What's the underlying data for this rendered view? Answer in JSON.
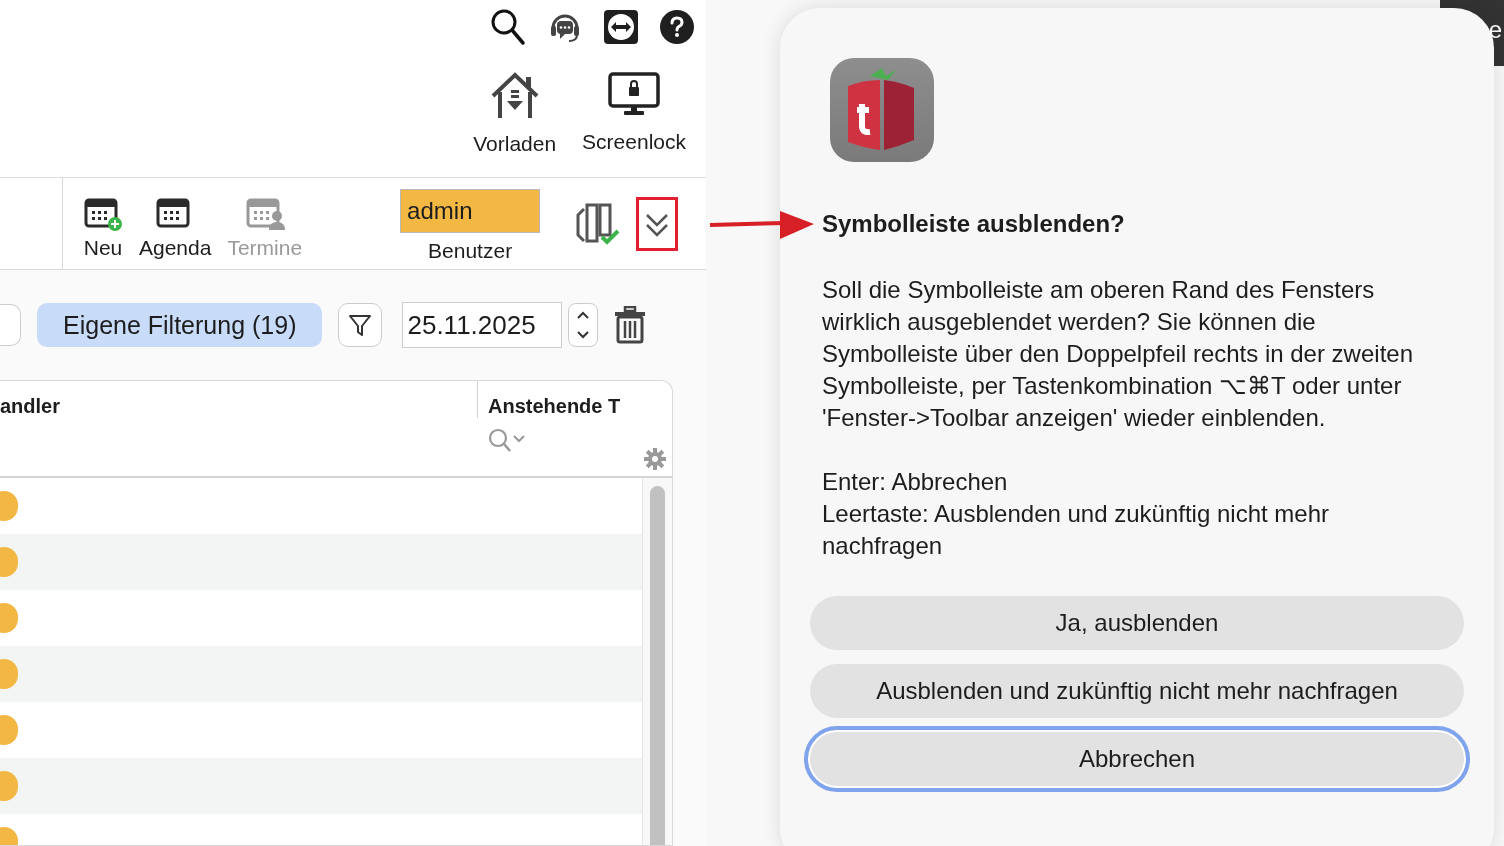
{
  "top_toolbar": {
    "actions": [
      {
        "label": "Vorladen"
      },
      {
        "label": "Screenlock"
      }
    ]
  },
  "second_toolbar": {
    "buttons": [
      {
        "label": "Neu",
        "disabled": false
      },
      {
        "label": "Agenda",
        "disabled": false
      },
      {
        "label": "Termine",
        "disabled": true
      }
    ],
    "user_field": {
      "value": "admin",
      "label": "Benutzer"
    }
  },
  "filter_bar": {
    "filter_chip": "Eigene Filterung (19)",
    "date_field": {
      "value": "25.11.2025"
    }
  },
  "table": {
    "columns": [
      {
        "label": "andler"
      },
      {
        "label": "Anstehende T"
      }
    ],
    "rows": [
      {
        "color": "#f2b843"
      },
      {
        "color": "#f2b843"
      },
      {
        "color": "#f2b843"
      },
      {
        "color": "#f2b843"
      },
      {
        "color": "#f2b843"
      },
      {
        "color": "#f2b843"
      },
      {
        "color": "#f2b843"
      }
    ]
  },
  "edge_label": "e",
  "dialog": {
    "title": "Symbolleiste ausblenden?",
    "message": "Soll die Symbolleiste am oberen Rand des Fensters wirklich ausgeblendet werden? Sie können die Symbolleiste über den Doppelpfeil rechts in der zweiten Symbolleiste, per Tastenkombination ⌥⌘T oder unter 'Fenster->Toolbar anzeigen' wieder einblenden.",
    "hints": [
      "Enter: Abbrechen",
      "Leertaste: Ausblenden und zukünftig nicht mehr nachfragen"
    ],
    "buttons": [
      {
        "label": "Ja, ausblenden",
        "focused": false
      },
      {
        "label": "Ausblenden und zukünftig nicht mehr nachfragen",
        "focused": false
      },
      {
        "label": "Abbrechen",
        "focused": true
      }
    ]
  }
}
